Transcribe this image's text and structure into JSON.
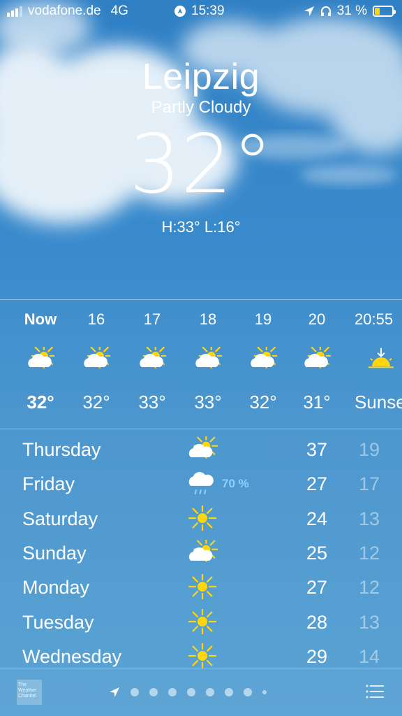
{
  "status": {
    "carrier": "vodafone.de",
    "network": "4G",
    "time": "15:39",
    "battery": "31 %",
    "battery_level": 0.31,
    "icons": [
      "signal-icon",
      "location-active-icon",
      "location-arrow-icon",
      "headphones-icon",
      "battery-charging-icon"
    ]
  },
  "header": {
    "city": "Leipzig",
    "condition": "Partly Cloudy",
    "temperature": "32°",
    "hilo": "H:33°  L:16°"
  },
  "hourly": [
    {
      "time": "Now",
      "temp": "32°",
      "icon": "partly-cloudy-icon"
    },
    {
      "time": "16",
      "temp": "32°",
      "icon": "partly-cloudy-icon"
    },
    {
      "time": "17",
      "temp": "33°",
      "icon": "partly-cloudy-icon"
    },
    {
      "time": "18",
      "temp": "33°",
      "icon": "partly-cloudy-icon"
    },
    {
      "time": "19",
      "temp": "32°",
      "icon": "partly-cloudy-icon"
    },
    {
      "time": "20",
      "temp": "31°",
      "icon": "partly-cloudy-icon"
    },
    {
      "time": "20:55",
      "temp": "Sunset",
      "icon": "sunset-icon"
    }
  ],
  "daily": [
    {
      "day": "Thursday",
      "icon": "partly-cloudy-icon",
      "precip": "",
      "high": "37",
      "low": "19"
    },
    {
      "day": "Friday",
      "icon": "rain-cloud-icon",
      "precip": "70 %",
      "high": "27",
      "low": "17"
    },
    {
      "day": "Saturday",
      "icon": "sun-icon",
      "precip": "",
      "high": "24",
      "low": "13"
    },
    {
      "day": "Sunday",
      "icon": "partly-cloudy-icon",
      "precip": "",
      "high": "25",
      "low": "12"
    },
    {
      "day": "Monday",
      "icon": "sun-icon",
      "precip": "",
      "high": "27",
      "low": "12"
    },
    {
      "day": "Tuesday",
      "icon": "sun-icon",
      "precip": "",
      "high": "28",
      "low": "13"
    },
    {
      "day": "Wednesday",
      "icon": "sun-icon",
      "precip": "",
      "high": "29",
      "low": "14"
    }
  ],
  "bottom": {
    "logo_text": "The Weather Channel",
    "page_count": 9,
    "icons": [
      "weather-channel-logo",
      "location-arrow-icon",
      "list-icon"
    ]
  },
  "colors": {
    "sky_top": "#2f7fc4",
    "sky_bottom": "#5aa3d3",
    "sun": "#ffd60a",
    "precip": "#8fd0ff"
  }
}
